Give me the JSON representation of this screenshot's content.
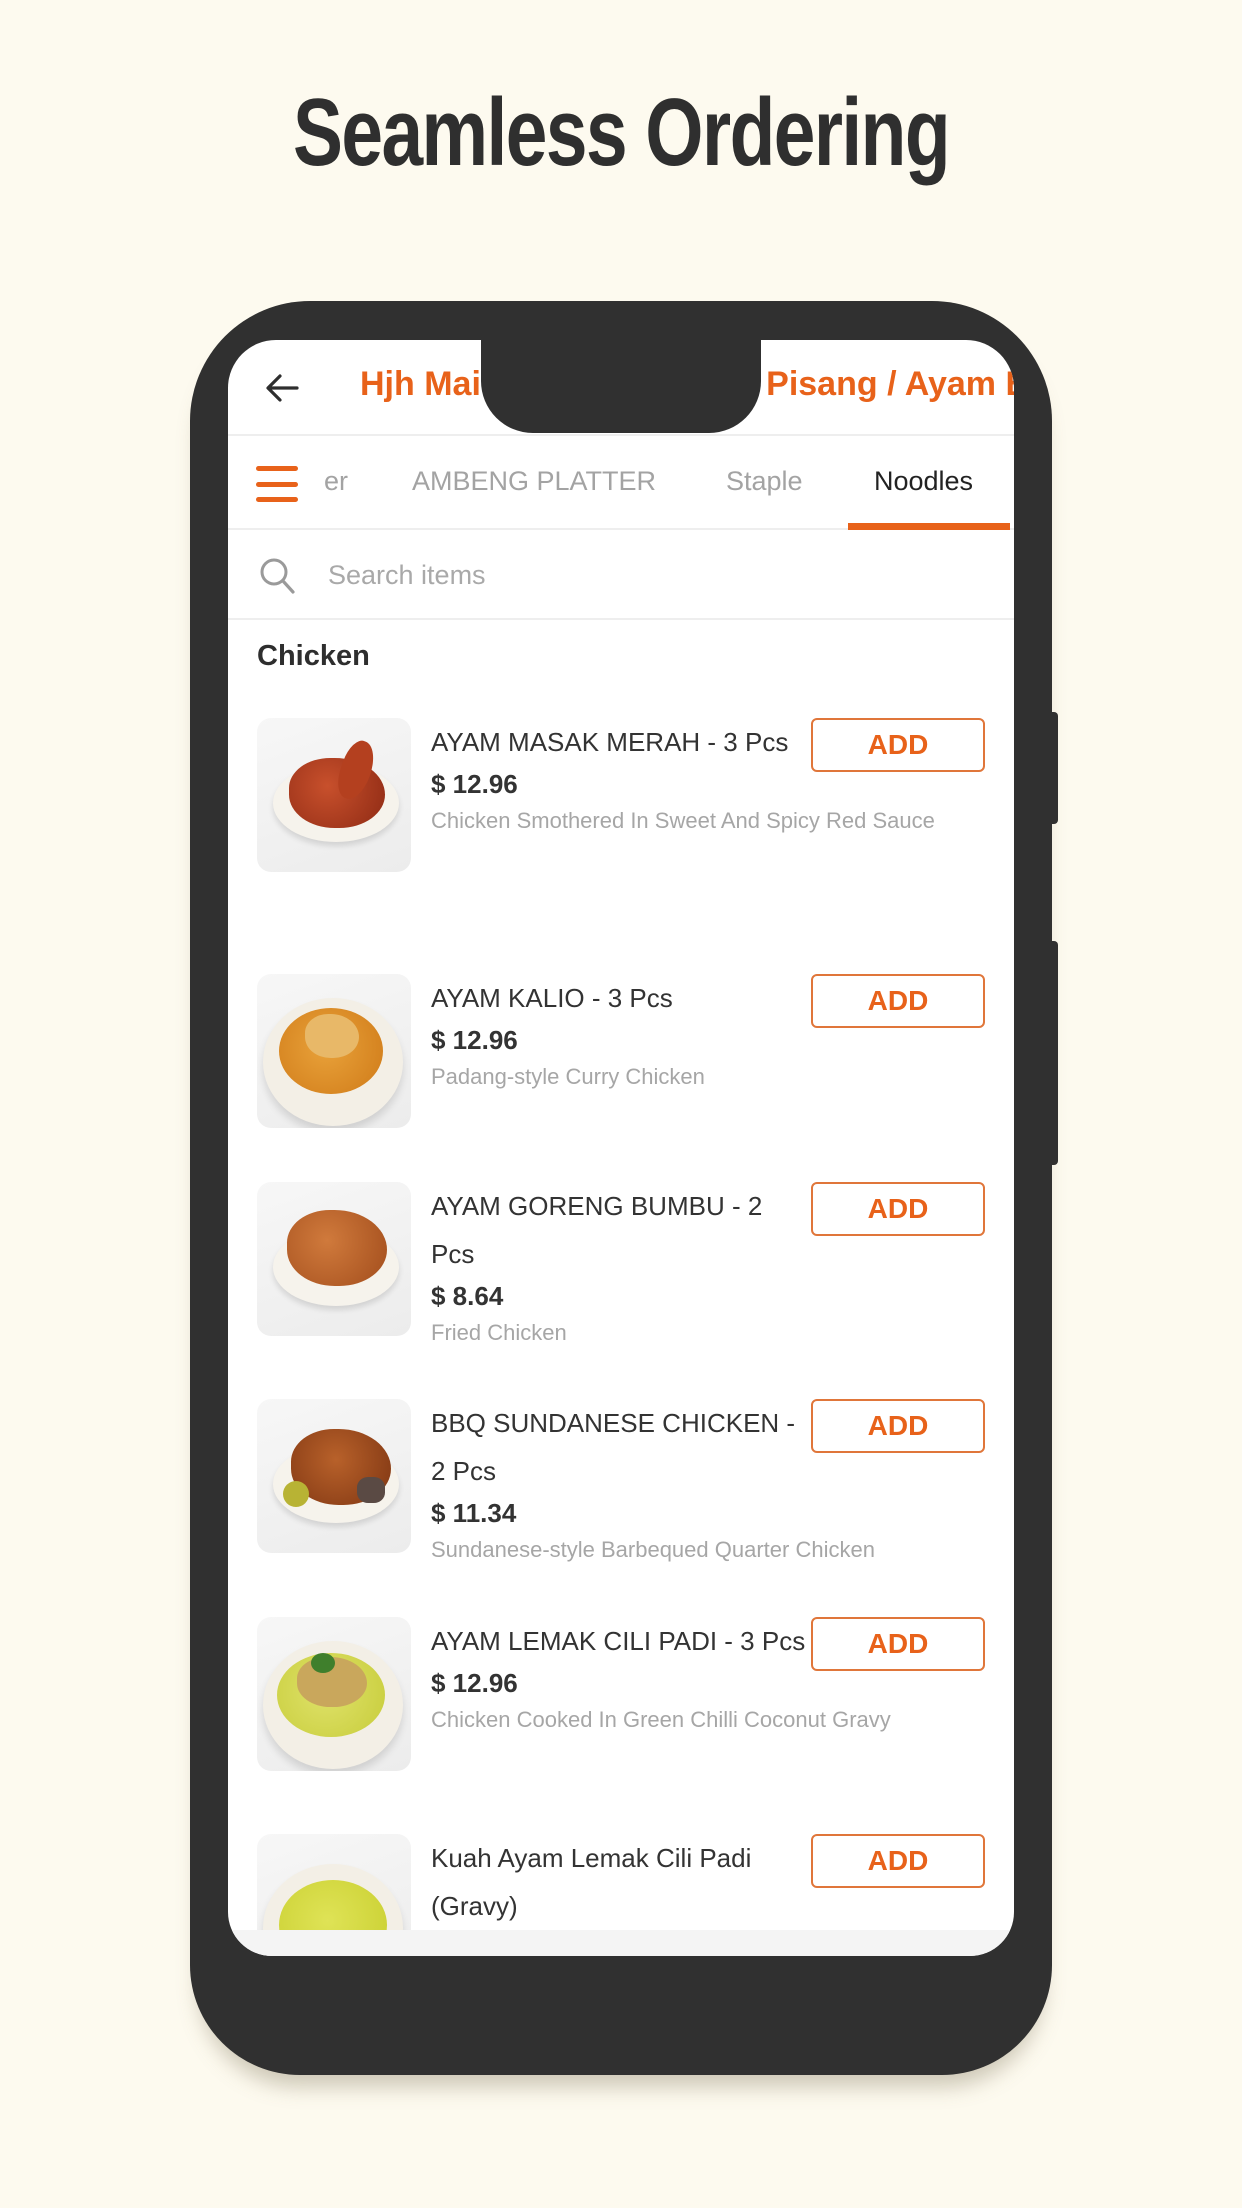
{
  "promo": {
    "headline": "Seamless Ordering"
  },
  "app": {
    "store_title": "Hjh Maimunah Mini – Jln Pisang / Ayam Bersiat",
    "store_title_visible": "Hjh Ma                    hiat",
    "back_icon": "arrow-left-icon",
    "menu_icon": "hamburger-menu-icon",
    "accent_color": "#e8621a"
  },
  "tabs": [
    {
      "label": "er",
      "active": false
    },
    {
      "label": "AMBENG PLATTER",
      "active": false
    },
    {
      "label": "Staple",
      "active": false
    },
    {
      "label": "Noodles",
      "active": true
    }
  ],
  "search": {
    "placeholder": "Search items",
    "value": "",
    "icon": "search-icon"
  },
  "section": {
    "title": "Chicken"
  },
  "items": [
    {
      "name": "AYAM MASAK MERAH - 3 Pcs",
      "price": "$ 12.96",
      "description": "Chicken Smothered In Sweet And Spicy Red Sauce",
      "button": "ADD"
    },
    {
      "name": "AYAM KALIO - 3 Pcs",
      "price": "$ 12.96",
      "description": "Padang-style Curry Chicken",
      "button": "ADD"
    },
    {
      "name": "AYAM GORENG BUMBU - 2 Pcs",
      "price": "$ 8.64",
      "description": "Fried Chicken",
      "button": "ADD"
    },
    {
      "name": "BBQ SUNDANESE CHICKEN - 2 Pcs",
      "price": "$ 11.34",
      "description": "Sundanese-style Barbequed  Quarter Chicken",
      "button": "ADD"
    },
    {
      "name": "AYAM LEMAK CILI PADI - 3 Pcs",
      "price": "$ 12.96",
      "description": "Chicken Cooked In Green Chilli Coconut Gravy",
      "button": "ADD"
    },
    {
      "name": "Kuah Ayam Lemak Cili Padi (Gravy)",
      "price": "",
      "description": "",
      "button": "ADD"
    }
  ]
}
